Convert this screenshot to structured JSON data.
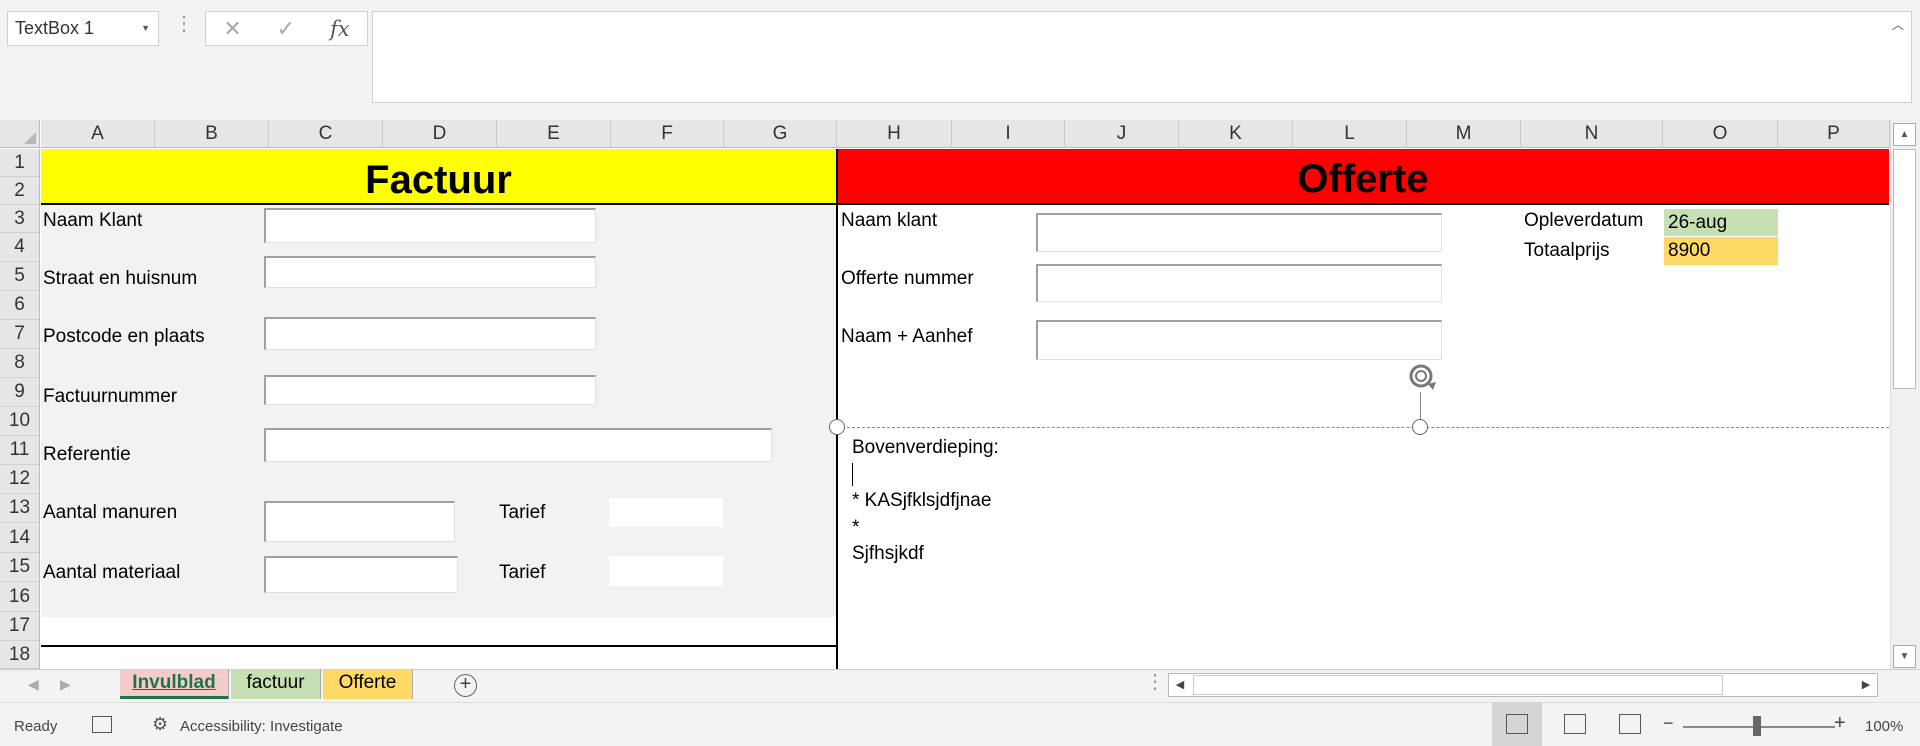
{
  "formula_bar": {
    "name_box": "TextBox 1",
    "cancel_icon": "x-icon",
    "enter_icon": "check-icon",
    "fx_label": "fx",
    "content": ""
  },
  "columns": [
    "A",
    "B",
    "C",
    "D",
    "E",
    "F",
    "G",
    "H",
    "I",
    "J",
    "K",
    "L",
    "M",
    "N",
    "O",
    "P"
  ],
  "rows": [
    "1",
    "2",
    "3",
    "4",
    "5",
    "6",
    "7",
    "8",
    "9",
    "10",
    "11",
    "12",
    "13",
    "14",
    "15",
    "16",
    "17",
    "18"
  ],
  "sheet": {
    "factuur_title": "Factuur",
    "offerte_title": "Offerte",
    "factuur_labels": {
      "naam_klant": "Naam Klant",
      "straat": "Straat en huisnum",
      "postcode": "Postcode en plaats",
      "factuurnummer": "Factuurnummer",
      "referentie": "Referentie",
      "aantal_manuren": "Aantal manuren",
      "tarief_1": "Tarief",
      "aantal_materiaal": "Aantal materiaal",
      "tarief_2": "Tarief"
    },
    "offerte_labels": {
      "naam_klant": "Naam klant",
      "offerte_nummer": "Offerte nummer",
      "naam_aanhef": "Naam + Aanhef",
      "opleverdatum_label": "Opleverdatum",
      "opleverdatum_value": "26-aug",
      "totaalprijs_label": "Totaalprijs",
      "totaalprijs_value": "8900"
    },
    "textbox_lines": [
      "Bovenverdieping:",
      "",
      "* KASjfklsjdfjnae",
      "*",
      "Sjfhsjkdf"
    ]
  },
  "tabs": [
    {
      "label": "Invulblad",
      "color": "#f4cccc",
      "active": true
    },
    {
      "label": "factuur",
      "color": "#c6e0b4",
      "active": false
    },
    {
      "label": "Offerte",
      "color": "#ffd966",
      "active": false
    }
  ],
  "status": {
    "ready": "Ready",
    "accessibility": "Accessibility: Investigate",
    "zoom": "100%"
  },
  "colors": {
    "factuur_banner": "#ffff00",
    "offerte_banner": "#ff0000",
    "accent": "#217346"
  }
}
